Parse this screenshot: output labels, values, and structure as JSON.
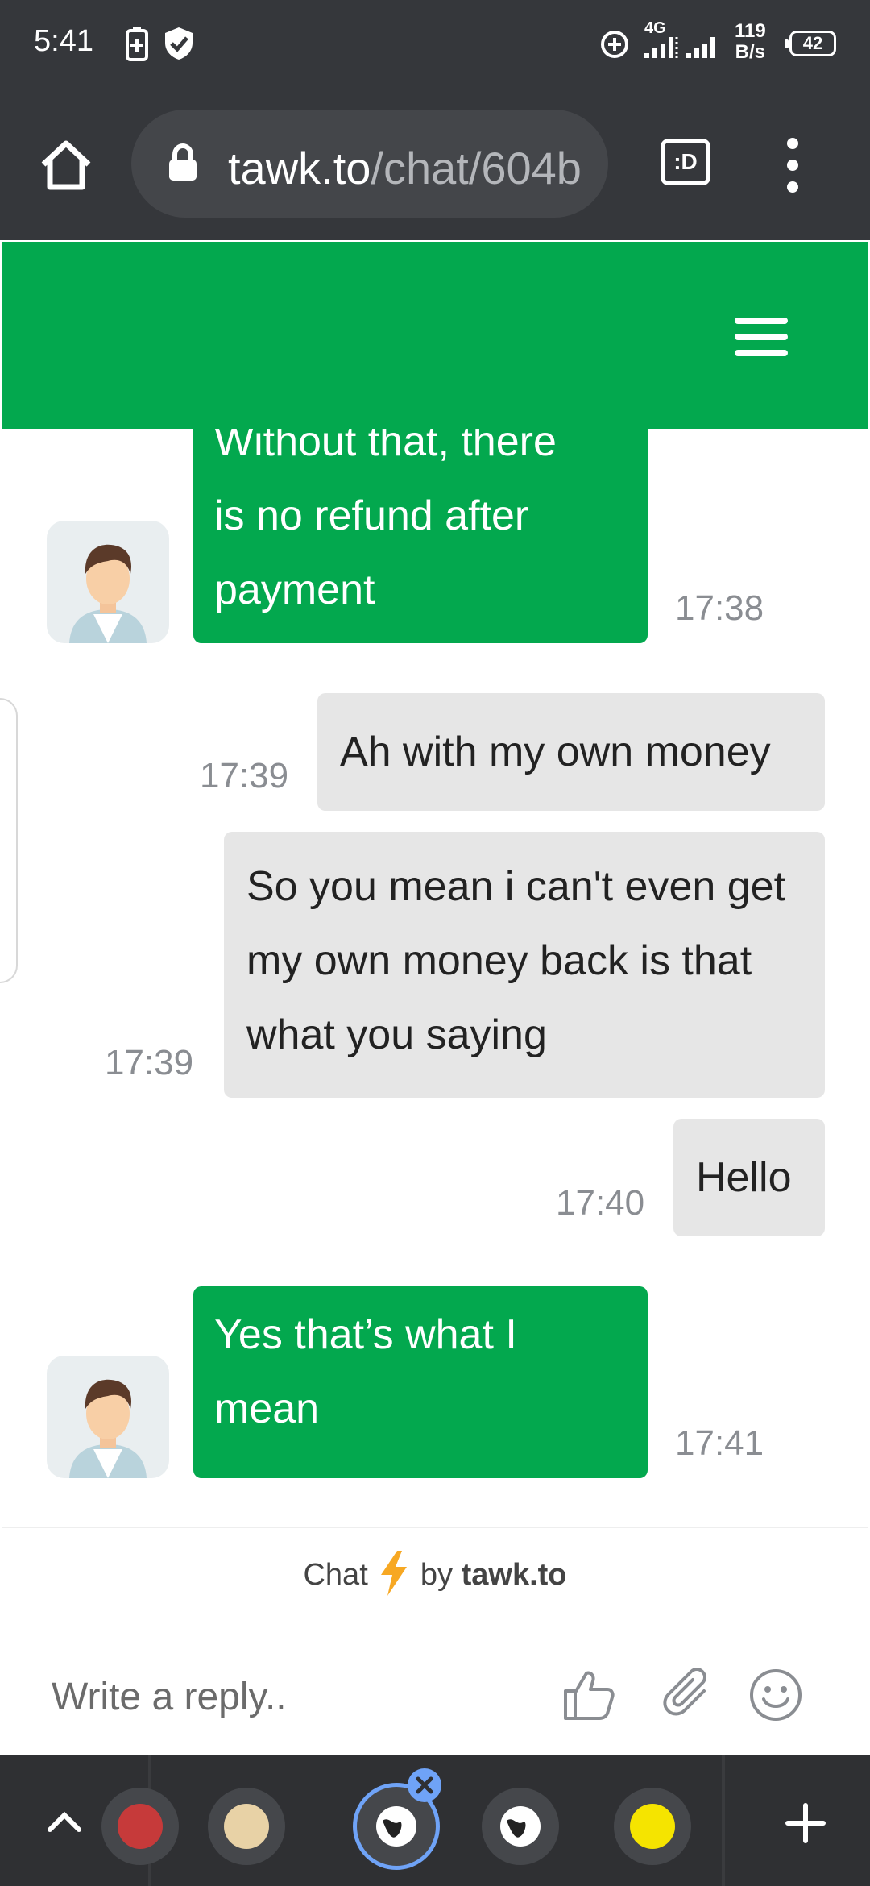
{
  "status_bar": {
    "time": "5:41",
    "network_type": "4G",
    "net_speed_value": "119",
    "net_speed_unit": "B/s",
    "battery": "42"
  },
  "browser": {
    "url_domain": "tawk.to",
    "url_path": "/chat/604b",
    "tab_switcher_label": ":D"
  },
  "messages": [
    {
      "sender": "agent",
      "lines": [
        "Without that, there",
        "is no refund after",
        "payment"
      ],
      "time": "17:38"
    },
    {
      "sender": "visitor",
      "lines": [
        "Ah with my own money"
      ],
      "time": "17:39"
    },
    {
      "sender": "visitor",
      "lines": [
        "So you mean i can't even get",
        "my own money back is that",
        "what you saying"
      ],
      "time": "17:39"
    },
    {
      "sender": "visitor",
      "lines": [
        "Hello"
      ],
      "time": "17:40"
    },
    {
      "sender": "agent",
      "lines": [
        "Yes that’s what I",
        "mean"
      ],
      "time": "17:41"
    }
  ],
  "footer": {
    "powered_prefix": "Chat",
    "powered_by": "by",
    "powered_brand": "tawk.to",
    "reply_placeholder": "Write a reply.."
  },
  "colors": {
    "brand_green": "#03a84e",
    "visitor_bubble": "#e6e6e6",
    "browser_chrome": "#35373b"
  }
}
